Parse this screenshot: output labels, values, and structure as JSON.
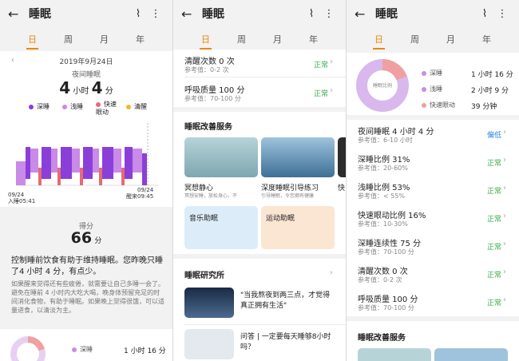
{
  "common": {
    "title": "睡眠",
    "tabs": [
      "日",
      "周",
      "月",
      "年"
    ],
    "back_icon": "←",
    "share_icon": "⌇",
    "more_icon": "⋮"
  },
  "p1": {
    "date": "2019年9月24日",
    "subtitle": "夜间睡眠",
    "hours": "4",
    "hour_unit": "小时",
    "minutes": "4",
    "minute_unit": "分",
    "legend": [
      {
        "label": "深睡",
        "color": "#8a3fd8"
      },
      {
        "label": "浅睡",
        "color": "#c98ae8"
      },
      {
        "label": "快速眼动",
        "color": "#e86a75"
      },
      {
        "label": "清醒",
        "color": "#f2b82e"
      }
    ],
    "end_label_date": "09/24",
    "end_label_time": "醒来09:45",
    "start_label_date": "09/24",
    "start_label_time": "入睡05:41",
    "score_label": "得分",
    "score": "66",
    "score_unit": "分",
    "advice_title": "控制睡前饮食有助于维持睡眠。您昨晚只睡了4 小时 4 分，有点少。",
    "advice_body": "如果醒来觉得还有些疲倦，就需要让自己多睡一会了。避免在睡前 4 小时内大吃大喝，晚身体预留充足的时间消化食物，有助于睡眠。如果晚上觉得很饿，可以适量进食，以清淡为主。",
    "ring": {
      "deep_label": "深睡",
      "deep_value": "1 小时 16 分"
    }
  },
  "p2": {
    "rows": [
      {
        "title": "清醒次数 0 次",
        "ref": "参考值：0-2 次",
        "tag": "正常"
      },
      {
        "title": "呼吸质量 100 分",
        "ref": "参考值：70-100 分",
        "tag": "正常"
      }
    ],
    "service_title": "睡眠改善服务",
    "services": [
      {
        "label": "冥想静心",
        "sub": "冥想安睡，放松身心，不",
        "sub2": "远离焦虑"
      },
      {
        "label": "深度睡眠引导练习",
        "sub": "引导睡眠，令您拥有健康"
      },
      {
        "label": "快"
      }
    ],
    "music": "音乐助眠",
    "sport": "运动助眠",
    "research_title": "睡眠研究所",
    "articles": [
      {
        "title": "\"当我熬夜到两三点，才觉得真正拥有生活\""
      },
      {
        "title": "问答 | 一定要每天睡够8小时吗？"
      }
    ]
  },
  "p3": {
    "pie_center": "睡眠比例",
    "legend": [
      {
        "label": "深睡",
        "value": "1 小时 16 分",
        "color": "#c98ae8"
      },
      {
        "label": "浅睡",
        "value": "2 小时 9 分",
        "color": "#c98ae8"
      },
      {
        "label": "快速眼动",
        "value": "39 分钟",
        "color": "#f0a0a0"
      }
    ],
    "rows": [
      {
        "title": "夜间睡眠 4 小时 4 分",
        "ref": "参考值：6-10 小时",
        "tag": "偏低",
        "warn": true
      },
      {
        "title": "深睡比例 31%",
        "ref": "参考值：20-60%",
        "tag": "正常"
      },
      {
        "title": "浅睡比例 53%",
        "ref": "参考值：< 55%",
        "tag": "正常"
      },
      {
        "title": "快速眼动比例 16%",
        "ref": "参考值：10-30%",
        "tag": "正常"
      },
      {
        "title": "深睡连续性 75 分",
        "ref": "参考值：70-100 分",
        "tag": "正常"
      },
      {
        "title": "清醒次数 0 次",
        "ref": "参考值：0-2 次",
        "tag": "正常"
      },
      {
        "title": "呼吸质量 100 分",
        "ref": "参考值：70-100 分",
        "tag": "正常"
      }
    ],
    "service_title": "睡眠改善服务"
  },
  "colors": {
    "accent": "#e8890c",
    "ok": "#3aa84c",
    "low": "#2b86d9"
  }
}
